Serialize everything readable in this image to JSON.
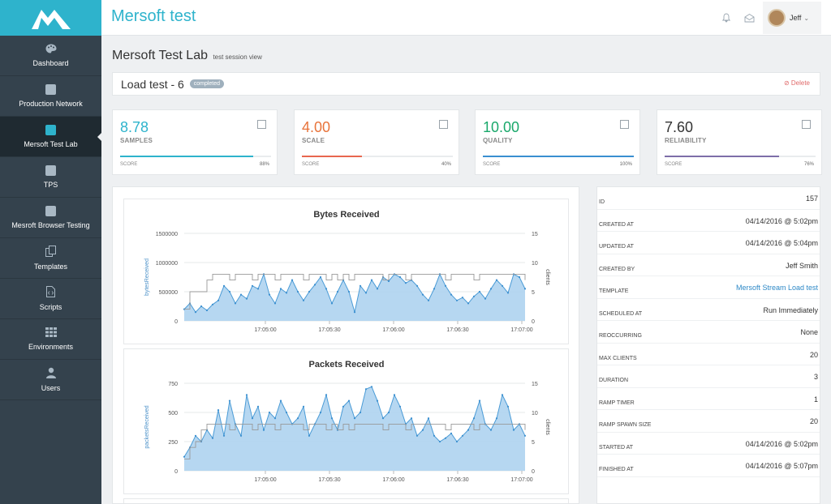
{
  "app": {
    "title": "Mersoft test",
    "logo_icon": "mersoft-m-logo"
  },
  "user": {
    "name": "Jeff",
    "avatar_icon": "user-avatar"
  },
  "topbar": {
    "icons": [
      "bell-icon",
      "envelope-icon"
    ]
  },
  "sidebar": {
    "items": [
      {
        "label": "Dashboard",
        "icon": "palette-icon",
        "active": false
      },
      {
        "label": "Production Network",
        "icon": "square-icon",
        "active": false
      },
      {
        "label": "Mersoft Test Lab",
        "icon": "square-icon",
        "active": true
      },
      {
        "label": "TPS",
        "icon": "square-icon",
        "active": false
      },
      {
        "label": "Mesroft Browser Testing",
        "icon": "square-icon",
        "active": false
      },
      {
        "label": "Templates",
        "icon": "copy-icon",
        "active": false
      },
      {
        "label": "Scripts",
        "icon": "file-code-icon",
        "active": false
      },
      {
        "label": "Environments",
        "icon": "grid-icon",
        "active": false
      },
      {
        "label": "Users",
        "icon": "user-icon",
        "active": false
      }
    ]
  },
  "page": {
    "title": "Mersoft Test Lab",
    "subtitle": "test session view"
  },
  "session": {
    "title": "Load test - 6",
    "status": "completed",
    "delete_label": "Delete"
  },
  "cards": [
    {
      "value": "8.78",
      "label": "SAMPLES",
      "score_label": "SCORE",
      "percent": "88%",
      "fraction": 0.88,
      "color": "#2eb3cc"
    },
    {
      "value": "4.00",
      "label": "SCALE",
      "score_label": "SCORE",
      "percent": "40%",
      "fraction": 0.4,
      "color": "#e8743b"
    },
    {
      "value": "10.00",
      "label": "QUALITY",
      "score_label": "SCORE",
      "percent": "100%",
      "fraction": 1.0,
      "color": "#1aa86b"
    },
    {
      "value": "7.60",
      "label": "RELIABILITY",
      "score_label": "SCORE",
      "percent": "76%",
      "fraction": 0.76,
      "color": "#333333"
    }
  ],
  "card_bar_colors": [
    "#2eb3cc",
    "#e8674f",
    "#3a8fd0",
    "#7d6ea8"
  ],
  "details": [
    {
      "key": "ID",
      "value": "157"
    },
    {
      "key": "CREATED AT",
      "value": "04/14/2016 @ 5:02pm"
    },
    {
      "key": "UPDATED AT",
      "value": "04/14/2016 @ 5:04pm"
    },
    {
      "key": "CREATED BY",
      "value": "Jeff Smith"
    },
    {
      "key": "TEMPLATE",
      "value": "Mersoft Stream Load test",
      "link": true
    },
    {
      "key": "SCHEDULED AT",
      "value": "Run Immediately"
    },
    {
      "key": "REOCCURRING",
      "value": "None"
    },
    {
      "key": "MAX CLIENTS",
      "value": "20"
    },
    {
      "key": "DURATION",
      "value": "3"
    },
    {
      "key": "RAMP TIMER",
      "value": "1"
    },
    {
      "key": "RAMP SPAWN SIZE",
      "value": "20"
    },
    {
      "key": "STARTED AT",
      "value": "04/14/2016 @ 5:02pm"
    },
    {
      "key": "FINISHED AT",
      "value": "04/14/2016 @ 5:07pm"
    }
  ],
  "chart_data": [
    {
      "type": "area",
      "title": "Bytes Received",
      "ylabel": "bytesReceived",
      "y2label": "clients",
      "ylim": [
        0,
        1500000
      ],
      "y2lim": [
        0,
        15
      ],
      "yticks": [
        "1500000",
        "1000000",
        "500000",
        "0"
      ],
      "y2ticks": [
        "15",
        "10",
        "5",
        "0"
      ],
      "xticks": [
        "17:05:00",
        "17:05:30",
        "17:06:00",
        "17:06:30",
        "17:07:00"
      ],
      "series": [
        {
          "name": "bytesReceived",
          "values": [
            200000,
            300000,
            150000,
            250000,
            180000,
            280000,
            350000,
            600000,
            500000,
            300000,
            450000,
            380000,
            600000,
            550000,
            800000,
            450000,
            300000,
            550000,
            480000,
            700000,
            500000,
            350000,
            500000,
            620000,
            750000,
            550000,
            300000,
            500000,
            700000,
            500000,
            150000,
            600000,
            480000,
            700000,
            550000,
            750000,
            680000,
            800000,
            750000,
            650000,
            700000,
            600000,
            450000,
            350000,
            550000,
            800000,
            600000,
            450000,
            350000,
            400000,
            300000,
            420000,
            500000,
            380000,
            550000,
            700000,
            600000,
            480000,
            800000,
            750000,
            550000
          ]
        },
        {
          "name": "clients",
          "values": [
            2,
            5,
            5,
            5,
            7,
            8,
            8,
            8,
            7,
            8,
            8,
            8,
            7,
            8,
            8,
            8,
            7,
            8,
            8,
            8,
            8,
            7,
            8,
            8,
            8,
            7,
            8,
            7,
            8,
            7,
            8,
            8,
            8,
            8,
            8,
            7,
            8,
            8,
            8,
            7,
            8,
            8,
            8,
            8,
            8,
            8,
            7,
            8,
            8,
            8,
            8,
            7,
            8,
            8,
            8,
            8,
            8,
            8,
            8,
            8,
            7
          ]
        }
      ]
    },
    {
      "type": "area",
      "title": "Packets Received",
      "ylabel": "packetsReceived",
      "y2label": "clients",
      "ylim": [
        0,
        750
      ],
      "y2lim": [
        0,
        15
      ],
      "yticks": [
        "750",
        "500",
        "250",
        "0"
      ],
      "y2ticks": [
        "15",
        "10",
        "5",
        "0"
      ],
      "xticks": [
        "17:05:00",
        "17:05:30",
        "17:06:00",
        "17:06:30",
        "17:07:00"
      ],
      "series": [
        {
          "name": "packetsReceived",
          "values": [
            120,
            200,
            300,
            250,
            350,
            280,
            520,
            300,
            600,
            400,
            300,
            650,
            450,
            550,
            350,
            500,
            450,
            600,
            500,
            400,
            450,
            550,
            300,
            400,
            500,
            650,
            450,
            350,
            550,
            600,
            450,
            500,
            700,
            720,
            600,
            450,
            500,
            650,
            550,
            400,
            450,
            300,
            350,
            450,
            300,
            250,
            280,
            320,
            250,
            300,
            350,
            450,
            600,
            400,
            350,
            450,
            650,
            550,
            350,
            400,
            300
          ]
        },
        {
          "name": "clients",
          "values": [
            2,
            4,
            5,
            7,
            8,
            8,
            8,
            8,
            7,
            8,
            8,
            8,
            7,
            8,
            8,
            8,
            7,
            8,
            8,
            8,
            8,
            7,
            8,
            8,
            8,
            7,
            8,
            7,
            8,
            7,
            8,
            8,
            8,
            8,
            8,
            7,
            8,
            8,
            8,
            7,
            8,
            8,
            8,
            8,
            8,
            8,
            7,
            8,
            8,
            8,
            8,
            7,
            8,
            8,
            8,
            8,
            8,
            8,
            8,
            8,
            7
          ]
        }
      ]
    }
  ]
}
